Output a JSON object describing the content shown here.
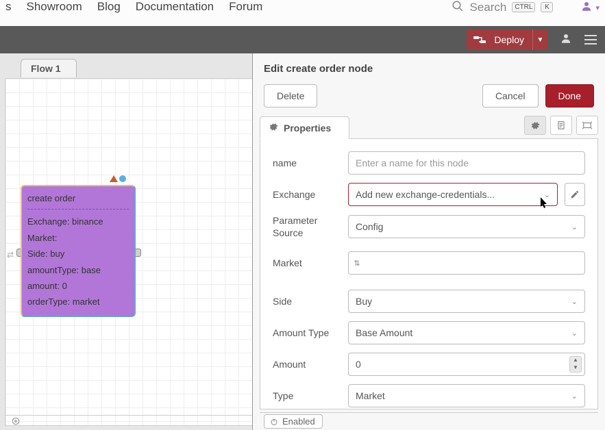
{
  "topnav": {
    "links": [
      "s",
      "Showroom",
      "Blog",
      "Documentation",
      "Forum"
    ],
    "search_label": "Search",
    "kbd1": "CTRL",
    "kbd2": "K"
  },
  "appbar": {
    "deploy": "Deploy"
  },
  "flow_tab": "Flow 1",
  "node": {
    "title": "create order",
    "rows": [
      {
        "k": "Exchange",
        "v": "binance"
      },
      {
        "k": "Market",
        "v": ""
      },
      {
        "k": "Side",
        "v": "buy"
      },
      {
        "k": "amountType",
        "v": "base"
      },
      {
        "k": "amount",
        "v": "0"
      },
      {
        "k": "orderType",
        "v": "market"
      }
    ]
  },
  "panel": {
    "title": "Edit create order node",
    "delete": "Delete",
    "cancel": "Cancel",
    "done": "Done",
    "properties_tab": "Properties",
    "enabled": "Enabled",
    "fields": {
      "name": {
        "label": "name",
        "placeholder": "Enter a name for this node"
      },
      "exchange": {
        "label": "Exchange",
        "value": "Add new exchange-credentials..."
      },
      "paramsource": {
        "label": "Parameter Source",
        "value": "Config"
      },
      "market": {
        "label": "Market"
      },
      "side": {
        "label": "Side",
        "value": "Buy"
      },
      "amounttype": {
        "label": "Amount Type",
        "value": "Base Amount"
      },
      "amount": {
        "label": "Amount",
        "value": "0"
      },
      "type": {
        "label": "Type",
        "value": "Market"
      }
    }
  }
}
